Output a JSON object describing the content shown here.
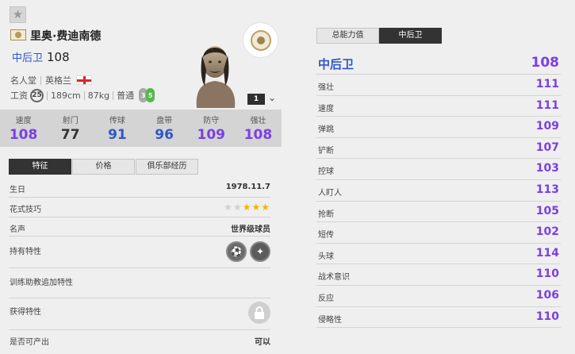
{
  "player": {
    "name": "里奥·费迪南德",
    "position": "中后卫",
    "overall": "108",
    "club": "名人堂",
    "nation": "英格兰",
    "wage_label": "工资",
    "wage": "25",
    "height": "189cm",
    "weight": "87kg",
    "body": "普通",
    "weak_foot": "3",
    "strong_foot": "5",
    "enhance_level": "1"
  },
  "stats": [
    {
      "label": "速度",
      "value": "108",
      "color": "#7b3fe4"
    },
    {
      "label": "射门",
      "value": "77",
      "color": "#333333"
    },
    {
      "label": "传球",
      "value": "91",
      "color": "#2f57c8"
    },
    {
      "label": "盘带",
      "value": "96",
      "color": "#2f57c8"
    },
    {
      "label": "防守",
      "value": "109",
      "color": "#7b3fe4"
    },
    {
      "label": "强壮",
      "value": "108",
      "color": "#7b3fe4"
    }
  ],
  "tabs": [
    "特征",
    "价格",
    "俱乐部经历"
  ],
  "details": {
    "birthday_label": "生日",
    "birthday": "1978.11.7",
    "skill_moves_label": "花式技巧",
    "skill_moves": 3,
    "skill_moves_max": 5,
    "reputation_label": "名声",
    "reputation": "世界级球员",
    "traits_label": "持有特性",
    "coach_traits_label": "训练助教追加特性",
    "acquired_traits_label": "获得特性",
    "producible_label": "是否可产出",
    "producible": "可以"
  },
  "right_tabs": [
    "总能力值",
    "中后卫"
  ],
  "position_rating": {
    "label": "中后卫",
    "value": "108"
  },
  "attributes": [
    {
      "label": "强壮",
      "value": "111"
    },
    {
      "label": "速度",
      "value": "111"
    },
    {
      "label": "弹跳",
      "value": "109"
    },
    {
      "label": "铲断",
      "value": "107"
    },
    {
      "label": "控球",
      "value": "103"
    },
    {
      "label": "人盯人",
      "value": "113"
    },
    {
      "label": "抢断",
      "value": "105"
    },
    {
      "label": "短传",
      "value": "102"
    },
    {
      "label": "头球",
      "value": "114"
    },
    {
      "label": "战术意识",
      "value": "110"
    },
    {
      "label": "反应",
      "value": "106"
    },
    {
      "label": "侵略性",
      "value": "110"
    }
  ],
  "icons": {
    "favorite": "star-icon",
    "season": "icon-season-badge-icon",
    "club": "icon-club-badge-icon",
    "traits": [
      "long-ball-trait-icon",
      "solid-player-trait-icon"
    ],
    "locked": "lock-icon"
  },
  "colors": {
    "purple": "#7b3fe4",
    "blue": "#2f57c8",
    "dark_tab": "#333333",
    "star": "#f0b400"
  }
}
